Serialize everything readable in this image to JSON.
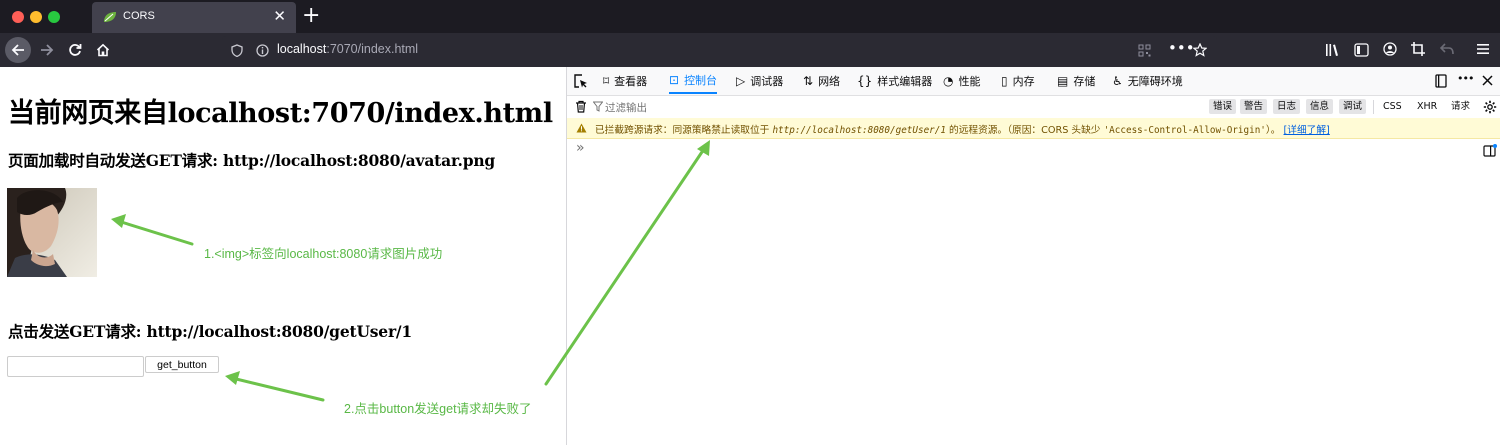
{
  "browser": {
    "tab_title": "CORS",
    "new_tab": "+",
    "tab_close": "✕",
    "url_host": "localhost",
    "url_rest": ":7070/index.html"
  },
  "page": {
    "heading": "当前网页来自localhost:7070/index.html",
    "section1": "页面加载时自动发送GET请求: http://localhost:8080/avatar.png",
    "section2": "点击发送GET请求: http://localhost:8080/getUser/1",
    "input_value": "",
    "button_label": "get_button"
  },
  "annotations": {
    "note1": "1.<img>标签向localhost:8080请求图片成功",
    "note2": "2.点击button发送get请求却失败了",
    "color": "#59b846"
  },
  "devtools": {
    "tabs": [
      {
        "label": "查看器",
        "icon": "inspector-icon"
      },
      {
        "label": "控制台",
        "icon": "console-icon"
      },
      {
        "label": "调试器",
        "icon": "debugger-icon"
      },
      {
        "label": "网络",
        "icon": "network-icon"
      },
      {
        "label": "样式编辑器",
        "icon": "style-editor-icon"
      },
      {
        "label": "性能",
        "icon": "performance-icon"
      },
      {
        "label": "内存",
        "icon": "memory-icon"
      },
      {
        "label": "存储",
        "icon": "storage-icon"
      },
      {
        "label": "无障碍环境",
        "icon": "accessibility-icon"
      }
    ],
    "active_tab": "控制台",
    "filter_placeholder": "过滤输出",
    "levels": [
      "错误",
      "警告",
      "日志",
      "信息",
      "调试"
    ],
    "extra_filters": [
      "CSS",
      "XHR",
      "请求"
    ],
    "warning": {
      "prefix": "已拦截跨源请求：同源策略禁止读取位于 ",
      "url": "http://localhost:8080/getUser/1",
      "middle": " 的远程资源。（原因：CORS 头缺少 ",
      "header": "'Access-Control-Allow-Origin'",
      "suffix": "）。",
      "link": "[详细了解]"
    },
    "prompt": "»",
    "accent": "#0a84ff"
  }
}
